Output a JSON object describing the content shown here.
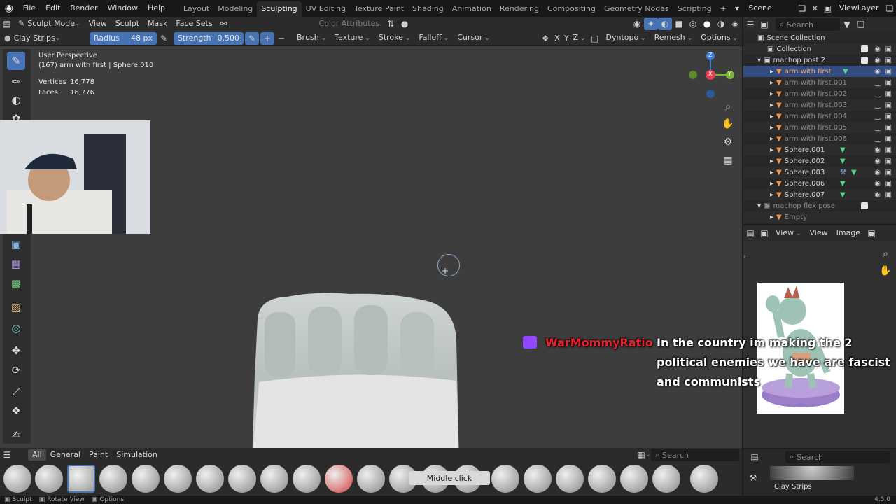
{
  "topbar": {
    "menus": [
      "File",
      "Edit",
      "Render",
      "Window",
      "Help"
    ],
    "workspaces": [
      "Layout",
      "Modeling",
      "Sculpting",
      "UV Editing",
      "Texture Paint",
      "Shading",
      "Animation",
      "Rendering",
      "Compositing",
      "Geometry Nodes",
      "Scripting"
    ],
    "active_workspace": "Sculpting",
    "add_tab": "+",
    "scene": "Scene",
    "view_layer": "ViewLayer"
  },
  "viewport_header": {
    "mode": "Sculpt Mode",
    "menus": [
      "View",
      "Sculpt",
      "Mask",
      "Face Sets"
    ],
    "color_attributes": "Color Attributes"
  },
  "tool_header": {
    "brush_name": "Clay Strips",
    "radius_label": "Radius",
    "radius_value": "48 px",
    "strength_label": "Strength",
    "strength_value": "0.500",
    "menus": [
      "Brush",
      "Texture",
      "Stroke",
      "Falloff",
      "Cursor"
    ],
    "axes": [
      "X",
      "Y",
      "Z"
    ],
    "dyntopo": "Dyntopo",
    "remesh": "Remesh",
    "options": "Options"
  },
  "viewport_info": {
    "perspective": "User Perspective",
    "object": "(167) arm with first | Sphere.010",
    "vertices_label": "Vertices",
    "vertices_value": "16,778",
    "faces_label": "Faces",
    "faces_value": "16,776"
  },
  "navigation_gizmo": {
    "x": "X",
    "y": "Y",
    "z": "Z"
  },
  "outliner": {
    "search_placeholder": "Search",
    "rows": [
      {
        "label": "Scene Collection"
      },
      {
        "label": "Collection"
      },
      {
        "label": "machop post 2"
      },
      {
        "label": "arm with first"
      },
      {
        "label": "arm with first.001"
      },
      {
        "label": "arm with first.002"
      },
      {
        "label": "arm with first.003"
      },
      {
        "label": "arm with first.004"
      },
      {
        "label": "arm with first.005"
      },
      {
        "label": "arm with first.006"
      },
      {
        "label": "Sphere.001"
      },
      {
        "label": "Sphere.002"
      },
      {
        "label": "Sphere.003"
      },
      {
        "label": "Sphere.006"
      },
      {
        "label": "Sphere.007"
      },
      {
        "label": "machop flex pose"
      },
      {
        "label": "Empty"
      }
    ]
  },
  "image_editor": {
    "menus": [
      "View",
      "View",
      "Image"
    ]
  },
  "chat_overlay": {
    "username": "WarMommyRatio",
    "lines": [
      "In the country im making the 2",
      "political enemies we have are fascist",
      "and communists"
    ]
  },
  "asset_shelf": {
    "tabs": [
      "All",
      "General",
      "Paint",
      "Simulation"
    ],
    "active_tab": "All",
    "search_placeholder": "Search",
    "tooltip": "Middle click"
  },
  "brush_panel": {
    "search_placeholder": "Search",
    "active_brush": "Clay Strips"
  },
  "status_bar": {
    "items": [
      "Sculpt",
      "Rotate View",
      "Options"
    ],
    "version": "4.5.0"
  },
  "colors": {
    "accent": "#4772b3",
    "viewport_bg": "#3d3d3d",
    "chat_username": "#e8202a"
  }
}
